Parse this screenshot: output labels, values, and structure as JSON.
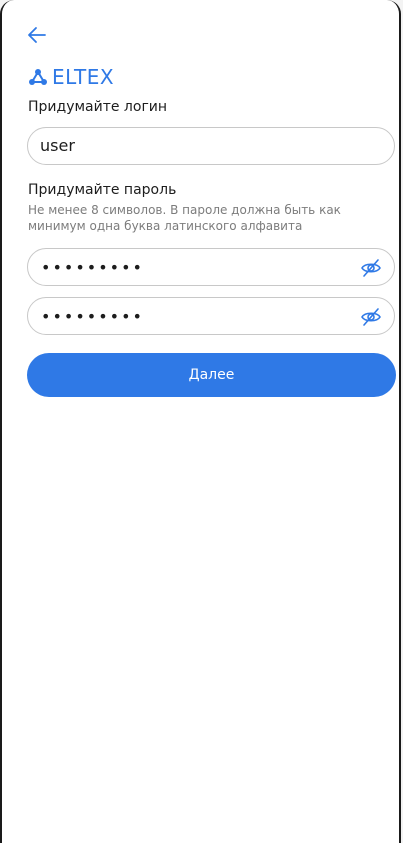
{
  "brand": {
    "name": "ELTEX",
    "logo_color": "#2f79e6"
  },
  "nav": {
    "back_icon": "arrow-left-icon"
  },
  "login": {
    "label": "Придумайте логин",
    "value": "user"
  },
  "password": {
    "label": "Придумайте пароль",
    "hint": "Не менее 8 символов. В пароле должна быть как минимум одна буква латинского алфавита",
    "value_masked": "•••••••••",
    "confirm_masked": "•••••••••",
    "toggle_icon": "eye-off-icon"
  },
  "actions": {
    "next_label": "Далее",
    "accent": "#2f79e6"
  }
}
